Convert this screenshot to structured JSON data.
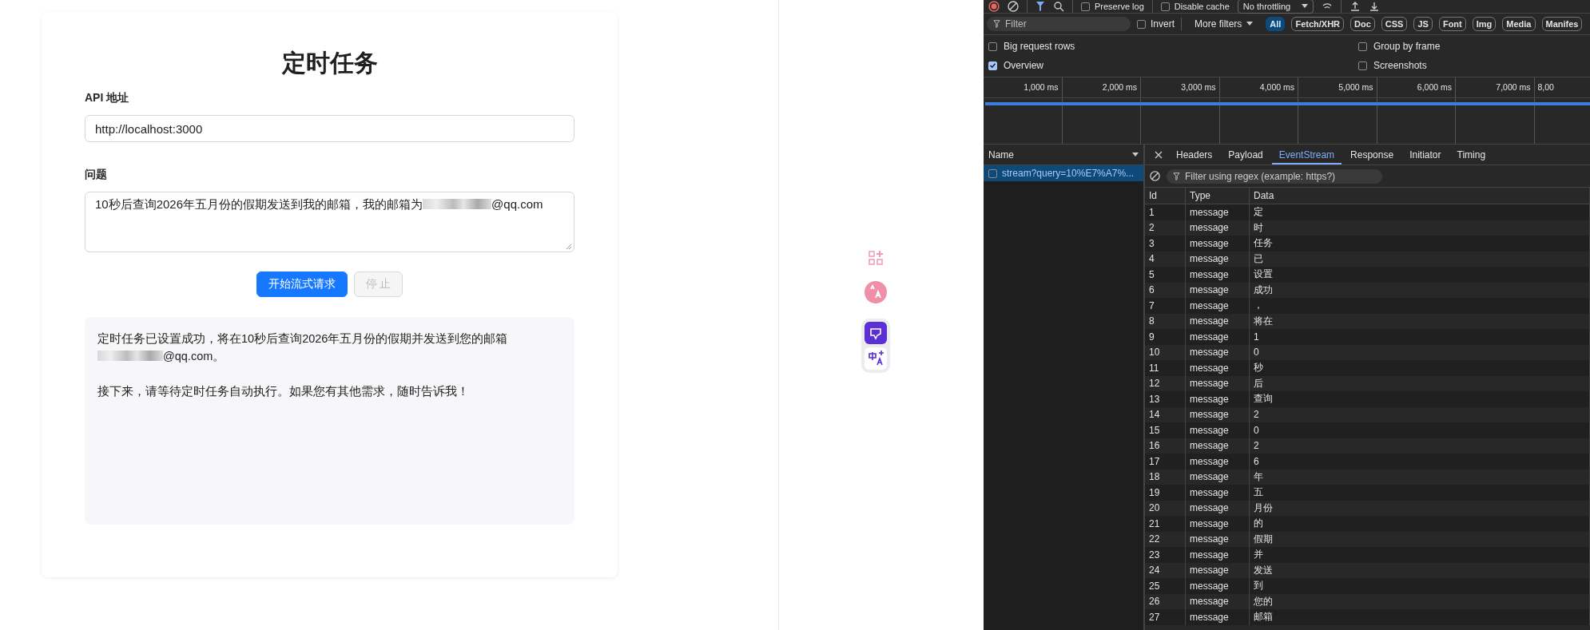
{
  "form": {
    "title": "定时任务",
    "api_label": "API 地址",
    "api_value": "http://localhost:3000",
    "question_label": "问题",
    "question_before": "10秒后查询2026年五月份的假期发送到我的邮箱，我的邮箱为",
    "question_after": "@qq.com",
    "buttons": [
      {
        "label": "开始流式请求",
        "disabled": false
      },
      {
        "label": "停 止",
        "disabled": true
      }
    ],
    "response": {
      "before": "定时任务已设置成功，将在10秒后查询2026年五月份的假期并发送到您的邮箱",
      "after": "@qq.com。",
      "next": "接下来，请等待定时任务自动执行。如果您有其他需求，随时告诉我！"
    }
  },
  "devtools": {
    "toolbar": {
      "checks": [
        {
          "label": "Preserve log",
          "checked": false
        },
        {
          "label": "Disable cache",
          "checked": false
        }
      ],
      "throttle": "No throttling"
    },
    "filter": {
      "placeholder": "Filter",
      "invert": {
        "label": "Invert",
        "checked": false
      },
      "more_filters": "More filters",
      "types": [
        {
          "label": "All",
          "selected": true
        },
        {
          "label": "Fetch/XHR",
          "selected": false
        },
        {
          "label": "Doc",
          "selected": false
        },
        {
          "label": "CSS",
          "selected": false
        },
        {
          "label": "JS",
          "selected": false
        },
        {
          "label": "Font",
          "selected": false
        },
        {
          "label": "Img",
          "selected": false
        },
        {
          "label": "Media",
          "selected": false
        },
        {
          "label": "Manifes",
          "selected": false
        }
      ]
    },
    "options": [
      {
        "label": "Big request rows",
        "checked": false
      },
      {
        "label": "Group by frame",
        "checked": false
      },
      {
        "label": "Overview",
        "checked": true
      },
      {
        "label": "Screenshots",
        "checked": false
      }
    ],
    "timeline_ticks": [
      "1,000 ms",
      "2,000 ms",
      "3,000 ms",
      "4,000 ms",
      "5,000 ms",
      "6,000 ms",
      "7,000 ms",
      "8,00"
    ],
    "requests": {
      "header": "Name",
      "items": [
        {
          "name": "stream?query=10%E7%A7%...",
          "selected": true,
          "checked": false
        }
      ]
    },
    "tabs": [
      {
        "label": "Headers",
        "selected": false
      },
      {
        "label": "Payload",
        "selected": false
      },
      {
        "label": "EventStream",
        "selected": true
      },
      {
        "label": "Response",
        "selected": false
      },
      {
        "label": "Initiator",
        "selected": false
      },
      {
        "label": "Timing",
        "selected": false
      }
    ],
    "event_filter": {
      "placeholder": "Filter using regex (example: https?)"
    },
    "columns": [
      "Id",
      "Type",
      "Data"
    ],
    "rows": [
      [
        "1",
        "message",
        "定"
      ],
      [
        "2",
        "message",
        "时"
      ],
      [
        "3",
        "message",
        "任务"
      ],
      [
        "4",
        "message",
        "已"
      ],
      [
        "5",
        "message",
        "设置"
      ],
      [
        "6",
        "message",
        "成功"
      ],
      [
        "7",
        "message",
        "，"
      ],
      [
        "8",
        "message",
        "将在"
      ],
      [
        "9",
        "message",
        "1"
      ],
      [
        "10",
        "message",
        "0"
      ],
      [
        "11",
        "message",
        "秒"
      ],
      [
        "12",
        "message",
        "后"
      ],
      [
        "13",
        "message",
        "查询"
      ],
      [
        "14",
        "message",
        "2"
      ],
      [
        "15",
        "message",
        "0"
      ],
      [
        "16",
        "message",
        "2"
      ],
      [
        "17",
        "message",
        "6"
      ],
      [
        "18",
        "message",
        "年"
      ],
      [
        "19",
        "message",
        "五"
      ],
      [
        "20",
        "message",
        "月份"
      ],
      [
        "21",
        "message",
        "的"
      ],
      [
        "22",
        "message",
        "假期"
      ],
      [
        "23",
        "message",
        "并"
      ],
      [
        "24",
        "message",
        "发送"
      ],
      [
        "25",
        "message",
        "到"
      ],
      [
        "26",
        "message",
        "您的"
      ],
      [
        "27",
        "message",
        "邮箱"
      ]
    ]
  }
}
